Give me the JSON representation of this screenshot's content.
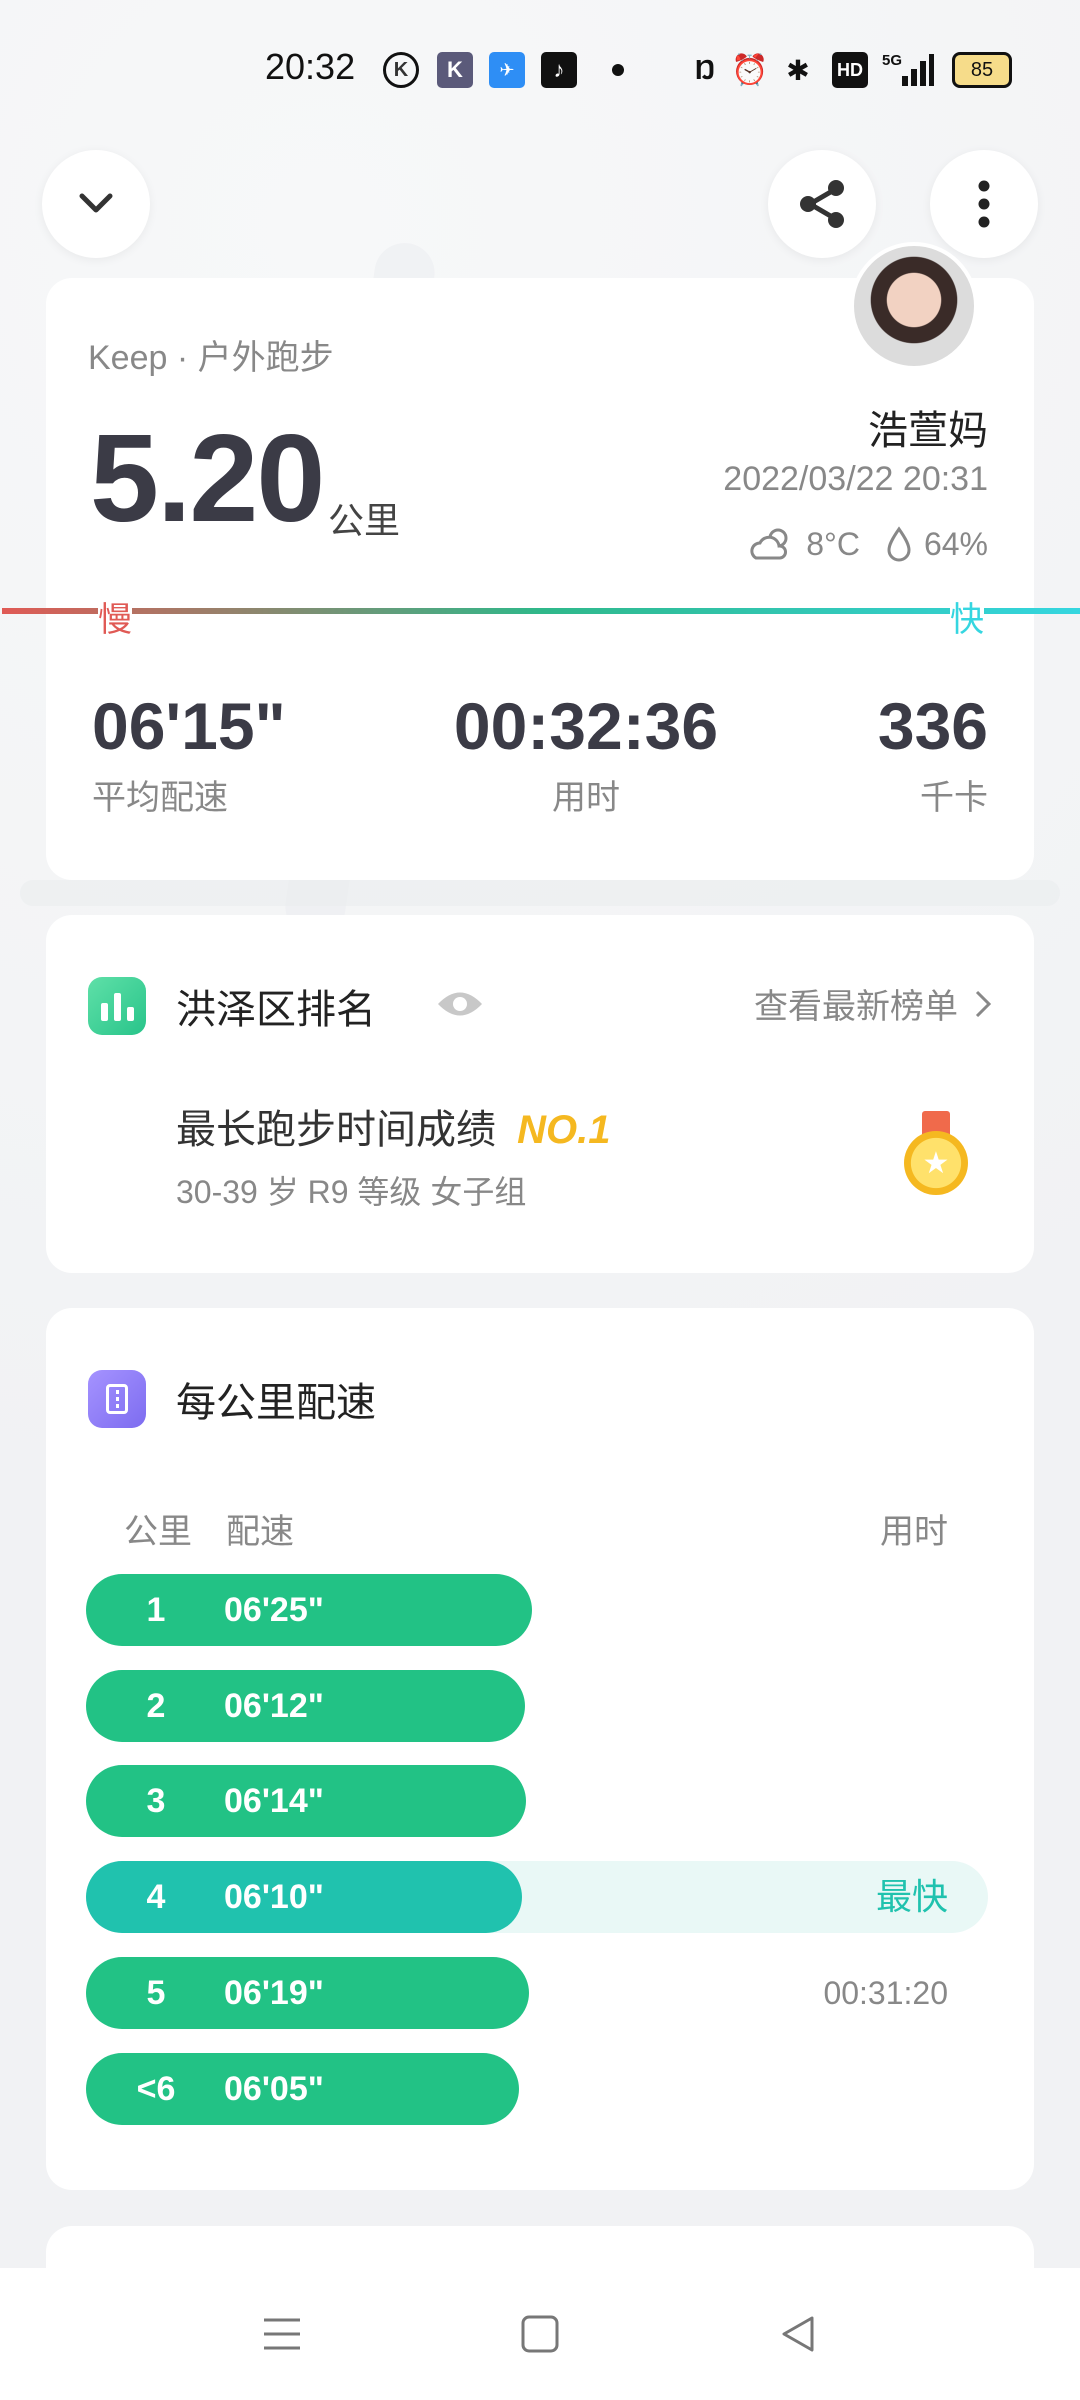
{
  "status_bar": {
    "time": "20:32",
    "network": "5G",
    "hd": "HD",
    "battery": "85"
  },
  "header": {
    "back_icon": "chevron-down-icon",
    "share_icon": "share-icon",
    "more_icon": "more-vertical-icon"
  },
  "summary": {
    "source": "Keep · 户外跑步",
    "distance": "5.20",
    "distance_unit": "公里",
    "user_name": "浩萱妈",
    "datetime": "2022/03/22 20:31",
    "temperature": "8°C",
    "humidity": "64%",
    "slow_label": "慢",
    "fast_label": "快",
    "stats": [
      {
        "value": "06'15\"",
        "label": "平均配速"
      },
      {
        "value": "00:32:36",
        "label": "用时"
      },
      {
        "value": "336",
        "label": "千卡"
      }
    ]
  },
  "ranking": {
    "title": "洪泽区排名",
    "link": "查看最新榜单",
    "achievement": "最长跑步时间成绩",
    "rank": "NO.1",
    "group": "30-39 岁 R9 等级 女子组"
  },
  "pace": {
    "title": "每公里配速",
    "col_km": "公里",
    "col_pace": "配速",
    "col_time": "用时",
    "rows": [
      {
        "km": "1",
        "pace": "06'25\"",
        "right": "",
        "fill": 0.494
      },
      {
        "km": "2",
        "pace": "06'12\"",
        "right": "",
        "fill": 0.487
      },
      {
        "km": "3",
        "pace": "06'14\"",
        "right": "",
        "fill": 0.488
      },
      {
        "km": "4",
        "pace": "06'10\"",
        "right": "最快",
        "fill": 0.483
      },
      {
        "km": "5",
        "pace": "06'19\"",
        "right": "00:31:20",
        "fill": 0.491
      },
      {
        "km": "<6",
        "pace": "06'05\"",
        "right": "",
        "fill": 0.48
      }
    ]
  },
  "colors": {
    "accent_green": "#22c285",
    "fastest_teal": "#20c2ae",
    "gold": "#f5b820",
    "slow_red": "#e05a55",
    "fast_cyan": "#35d6e0"
  }
}
